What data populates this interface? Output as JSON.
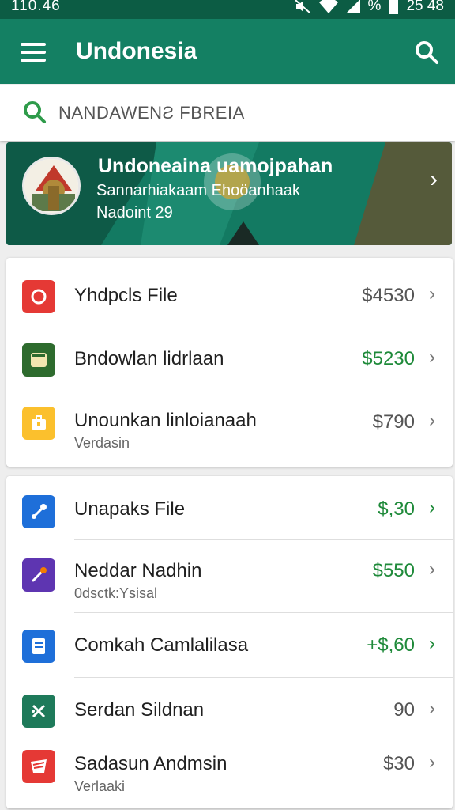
{
  "status_bar": {
    "time": "110.46",
    "battery": "%",
    "clock": "25 48"
  },
  "app_bar": {
    "title": "Undonesia"
  },
  "search": {
    "query": "NANDAWENƧ FBREIA"
  },
  "banner": {
    "title": "Undoneaina uamojpahan",
    "subtitle": "Sannarhiakaam Ehoöanhaak",
    "meta": "Nadoint 29"
  },
  "group1": [
    {
      "label": "Yhdpcls File",
      "sub": "",
      "price": "$4530",
      "price_color": "gray",
      "icon": "record-icon",
      "icon_color": "#e53935"
    },
    {
      "label": "Bndowlan lidrlaan",
      "sub": "",
      "price": "$5230",
      "price_color": "green",
      "icon": "tablet-icon",
      "icon_color": "#2e6b2e"
    },
    {
      "label": "Unounkan linloianaah",
      "sub": "Verdasin",
      "price": "$790",
      "price_color": "gray",
      "icon": "briefcase-icon",
      "icon_color": "#fbc02d"
    }
  ],
  "group2": [
    {
      "label": "Unapaks File",
      "sub": "",
      "price": "$,30",
      "price_color": "green",
      "icon": "wrench-icon",
      "icon_color": "#1e6fd9"
    },
    {
      "label": "Neddar Nadhin",
      "sub": "0dsctk:Ysisal",
      "price": "$550",
      "price_color": "green",
      "icon": "pencil-icon",
      "icon_color": "#5e35b1"
    },
    {
      "label": "Comkah Camlalilasa",
      "sub": "",
      "price": "+$,60",
      "price_color": "green",
      "icon": "document-icon",
      "icon_color": "#1e6fd9"
    },
    {
      "label": "Serdan Sildnan",
      "sub": "",
      "price": "90",
      "price_color": "gray",
      "icon": "scissors-icon",
      "icon_color": "#1e7a5a"
    },
    {
      "label": "Sadasun Andmsin",
      "sub": "Verlaaki",
      "price": "$30",
      "price_color": "gray",
      "icon": "mail-icon",
      "icon_color": "#e53935"
    }
  ]
}
